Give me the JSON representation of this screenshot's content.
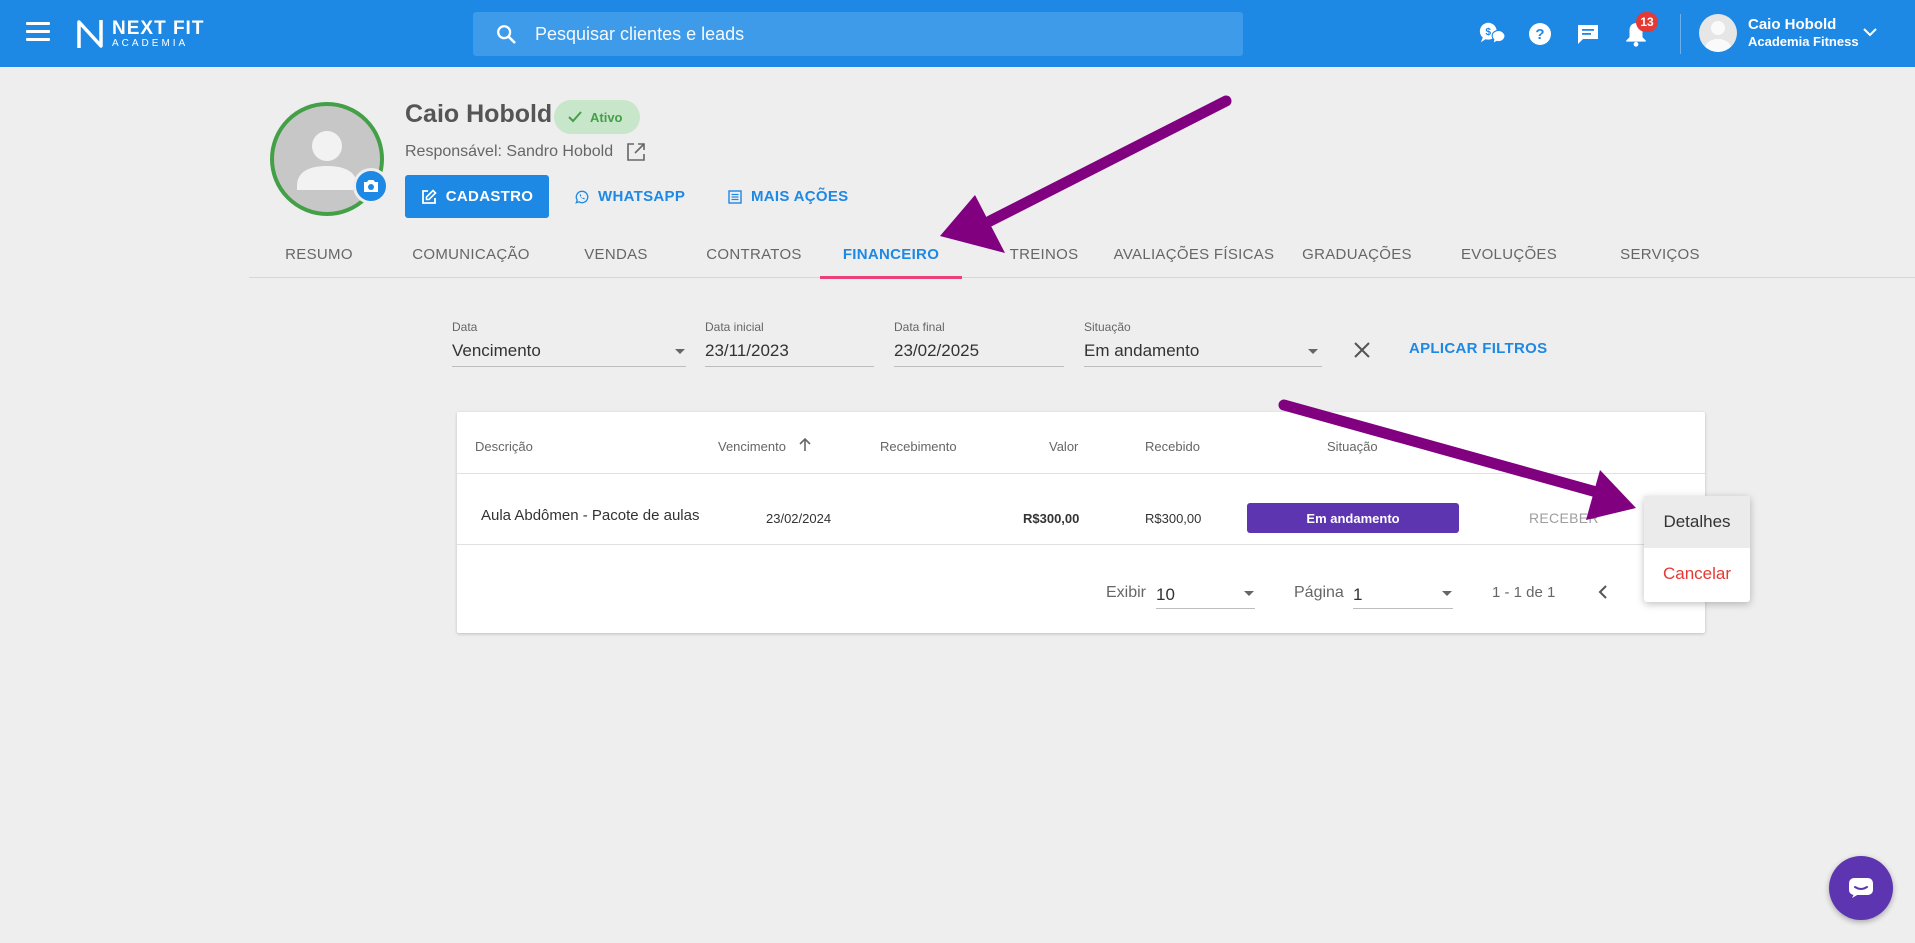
{
  "topbar": {
    "brand_line1": "NEXT FIT",
    "brand_line2": "ACADEMIA",
    "search_placeholder": "Pesquisar clientes e leads",
    "notifications_count": "13",
    "user_name": "Caio Hobold",
    "user_company": "Academia Fitness",
    "accent_color": "#1e88e5"
  },
  "profile": {
    "name": "Caio Hobold",
    "status": "Ativo",
    "responsible": "Responsável: Sandro Hobold",
    "actions": {
      "cadastro": "CADASTRO",
      "whatsapp": "WHATSAPP",
      "mais_acoes": "MAIS AÇÕES"
    }
  },
  "tabs": [
    {
      "label": "RESUMO"
    },
    {
      "label": "COMUNICAÇÃO"
    },
    {
      "label": "VENDAS"
    },
    {
      "label": "CONTRATOS"
    },
    {
      "label": "FINANCEIRO",
      "active": true
    },
    {
      "label": "TREINOS"
    },
    {
      "label": "AVALIAÇÕES FÍSICAS"
    },
    {
      "label": "GRADUAÇÕES"
    },
    {
      "label": "EVOLUÇÕES"
    },
    {
      "label": "SERVIÇOS"
    }
  ],
  "filters": {
    "data": {
      "label": "Data",
      "value": "Vencimento"
    },
    "data_inicial": {
      "label": "Data inicial",
      "value": "23/11/2023"
    },
    "data_final": {
      "label": "Data final",
      "value": "23/02/2025"
    },
    "situacao": {
      "label": "Situação",
      "value": "Em andamento"
    },
    "apply_label": "APLICAR FILTROS"
  },
  "table": {
    "headers": {
      "descricao": "Descrição",
      "vencimento": "Vencimento",
      "recebimento": "Recebimento",
      "valor": "Valor",
      "recebido": "Recebido",
      "situacao": "Situação"
    },
    "rows": [
      {
        "descricao": "Aula Abdômen - Pacote de aulas",
        "vencimento": "23/02/2024",
        "recebimento": "",
        "valor": "R$300,00",
        "recebido": "R$300,00",
        "situacao": "Em andamento",
        "action": "RECEBER"
      }
    ],
    "status_color": "#5e35b1"
  },
  "row_menu": {
    "detalhes": "Detalhes",
    "cancelar": "Cancelar"
  },
  "pagination": {
    "exibir_label": "Exibir",
    "exibir_value": "10",
    "pagina_label": "Página",
    "pagina_value": "1",
    "range": "1 - 1 de 1"
  },
  "annotation_color": "#800080"
}
